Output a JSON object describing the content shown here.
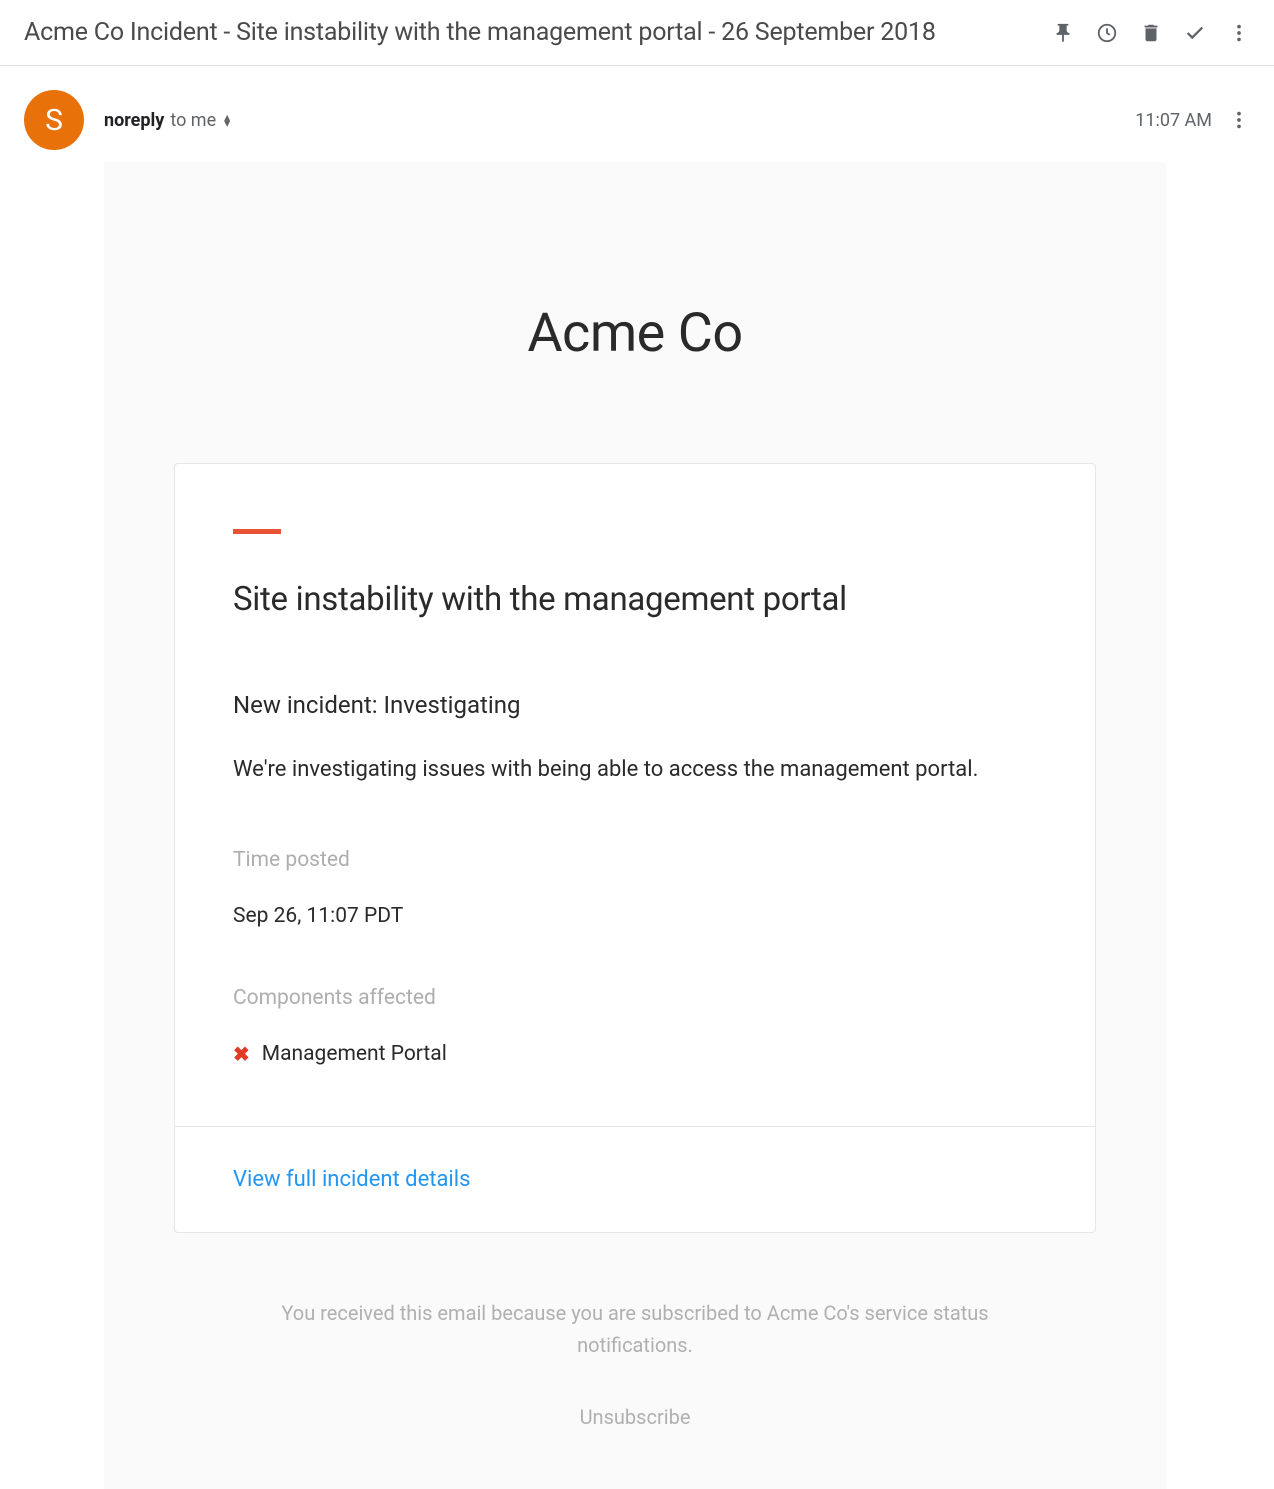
{
  "header": {
    "subject": "Acme Co Incident - Site instability with the management portal - 26 September 2018"
  },
  "sender": {
    "avatar_initial": "S",
    "name": "noreply",
    "recipient": "to me",
    "time": "11:07 AM"
  },
  "body": {
    "company": "Acme Co",
    "incident_title": "Site instability with the management portal",
    "status_heading": "New incident: Investigating",
    "status_description": "We're investigating issues with being able to access the management portal.",
    "time_posted_label": "Time posted",
    "time_posted_value": "Sep 26, 11:07 PDT",
    "components_label": "Components affected",
    "component_name": "Management Portal",
    "details_link": "View full incident details",
    "footer_text": "You received this email because you are subscribed to Acme Co's service status notifications.",
    "unsubscribe": "Unsubscribe"
  }
}
